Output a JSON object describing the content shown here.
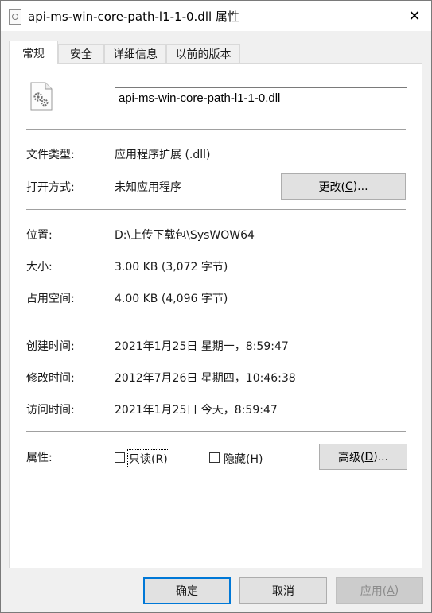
{
  "window": {
    "title": "api-ms-win-core-path-l1-1-0.dll 属性",
    "close_glyph": "✕"
  },
  "tabs": [
    {
      "label": "常规",
      "active": true
    },
    {
      "label": "安全",
      "active": false
    },
    {
      "label": "详细信息",
      "active": false
    },
    {
      "label": "以前的版本",
      "active": false
    }
  ],
  "general": {
    "file_name": "api-ms-win-core-path-l1-1-0.dll",
    "file_type_label": "文件类型:",
    "file_type_value": "应用程序扩展 (.dll)",
    "opens_with_label": "打开方式:",
    "opens_with_value": "未知应用程序",
    "change_button": {
      "text": "更改(",
      "mnemonic": "C",
      "suffix": ")..."
    },
    "location_label": "位置:",
    "location_value": "D:\\上传下载包\\SysWOW64",
    "size_label": "大小:",
    "size_value": "3.00 KB (3,072 字节)",
    "size_on_disk_label": "占用空间:",
    "size_on_disk_value": "4.00 KB (4,096 字节)",
    "created_label": "创建时间:",
    "created_value": "2021年1月25日 星期一，8:59:47",
    "modified_label": "修改时间:",
    "modified_value": "2012年7月26日 星期四，10:46:38",
    "accessed_label": "访问时间:",
    "accessed_value": "2021年1月25日 今天，8:59:47",
    "attributes_label": "属性:",
    "readonly": {
      "text": "只读(",
      "mnemonic": "R",
      "suffix": ")",
      "checked": false
    },
    "hidden": {
      "text": "隐藏(",
      "mnemonic": "H",
      "suffix": ")",
      "checked": false
    },
    "advanced_button": {
      "text": "高级(",
      "mnemonic": "D",
      "suffix": ")..."
    }
  },
  "footer": {
    "ok_label": "确定",
    "cancel_label": "取消",
    "apply": {
      "text": "应用(",
      "mnemonic": "A",
      "suffix": ")",
      "disabled": true
    }
  },
  "colors": {
    "default_button_border": "#0078d7",
    "panel_background": "#ffffff",
    "dialog_background": "#f0f0f0"
  }
}
